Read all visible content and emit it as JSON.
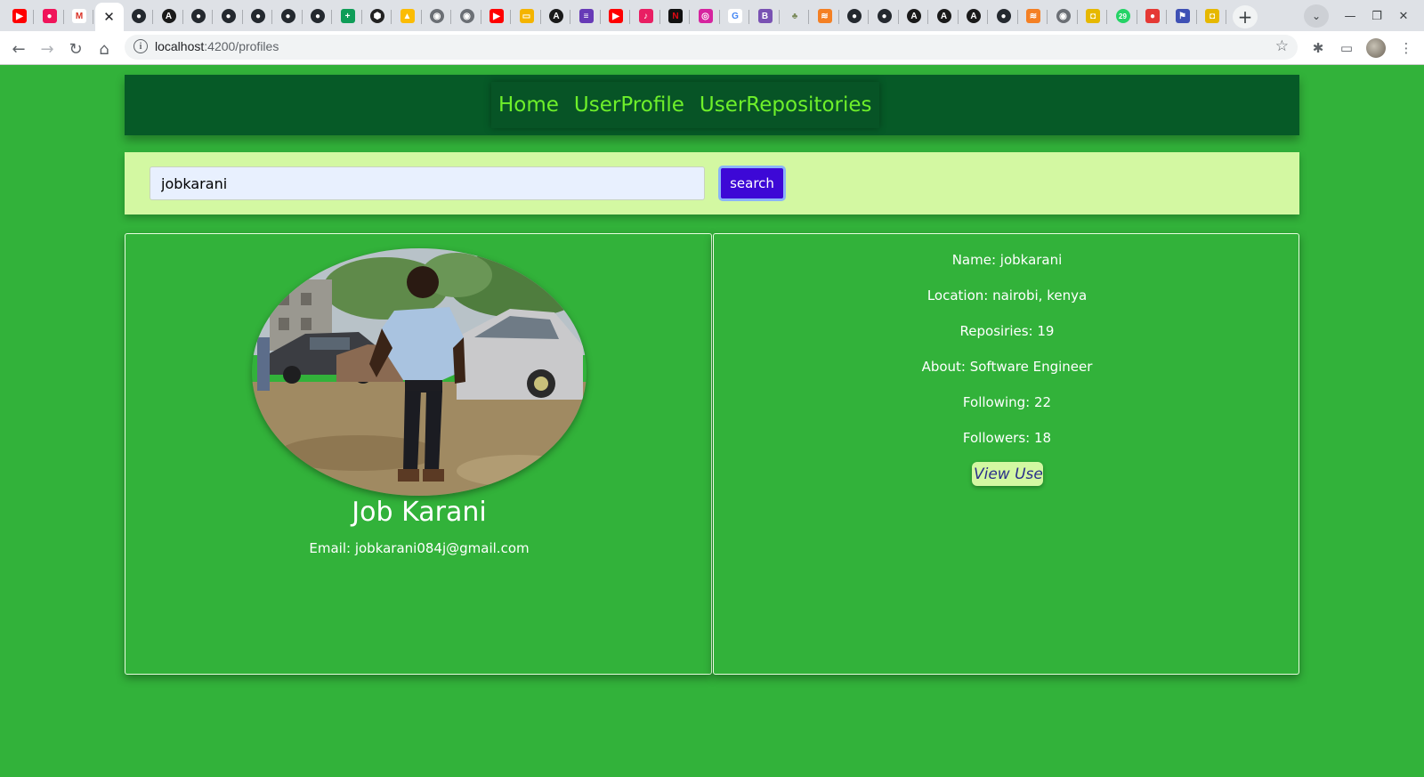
{
  "browser": {
    "tab_icons": [
      "youtube-icon",
      "music-icon",
      "gmail-icon",
      "active-tab",
      "github-icon",
      "angular-icon",
      "github-icon",
      "github-icon",
      "github-icon",
      "github-icon",
      "github-icon",
      "sheets-icon",
      "hex-icon",
      "drive-icon",
      "globe-icon",
      "globe-icon",
      "youtube-icon",
      "slides-icon",
      "angular-icon",
      "forms-icon",
      "youtube-icon",
      "app-icon",
      "netflix-icon",
      "instagram-icon",
      "google-icon",
      "bootstrap-icon",
      "tree-icon",
      "stackoverflow-icon",
      "github-icon",
      "github-icon",
      "angular-icon",
      "angular-icon",
      "angular-icon",
      "github-icon",
      "stackoverflow-icon",
      "globe-icon",
      "shield-icon",
      "whatsapp-icon",
      "record-icon",
      "flag-icon",
      "shield-icon"
    ],
    "url_host": "localhost",
    "url_path": ":4200/profiles",
    "whatsapp_badge": "29"
  },
  "nav": {
    "home": "Home",
    "profile": "UserProfile",
    "repos": "UserRepositories"
  },
  "search": {
    "value": "jobkarani",
    "button": "search"
  },
  "profile": {
    "fullname": "Job Karani",
    "email": "Email: jobkarani084j@gmail.com"
  },
  "details": {
    "name": "Name: jobkarani",
    "location": "Location: nairobi, kenya",
    "repos": "Reposiries: 19",
    "about": "About: Software Engineer",
    "following": "Following: 22",
    "followers": "Followers: 18",
    "view_button": "View User"
  },
  "colors": {
    "page_bg": "#32b23a",
    "navbar_bg": "#065a27",
    "nav_link": "#6ef02a",
    "search_bg": "#d3f8a2",
    "search_button": "#3d08d6"
  }
}
